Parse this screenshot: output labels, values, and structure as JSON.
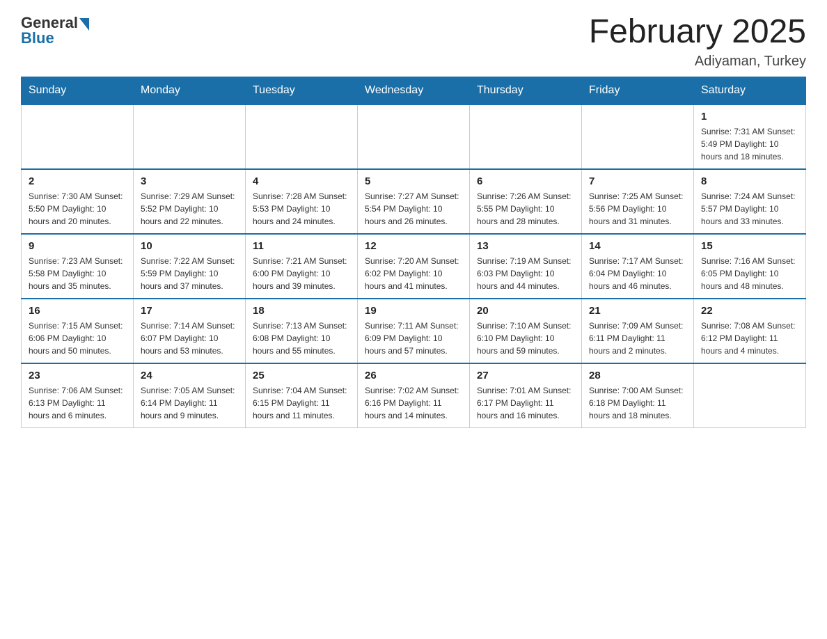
{
  "header": {
    "logo_general": "General",
    "logo_blue": "Blue",
    "month_title": "February 2025",
    "location": "Adiyaman, Turkey"
  },
  "days_of_week": [
    "Sunday",
    "Monday",
    "Tuesday",
    "Wednesday",
    "Thursday",
    "Friday",
    "Saturday"
  ],
  "weeks": [
    [
      {
        "day": "",
        "info": ""
      },
      {
        "day": "",
        "info": ""
      },
      {
        "day": "",
        "info": ""
      },
      {
        "day": "",
        "info": ""
      },
      {
        "day": "",
        "info": ""
      },
      {
        "day": "",
        "info": ""
      },
      {
        "day": "1",
        "info": "Sunrise: 7:31 AM\nSunset: 5:49 PM\nDaylight: 10 hours and 18 minutes."
      }
    ],
    [
      {
        "day": "2",
        "info": "Sunrise: 7:30 AM\nSunset: 5:50 PM\nDaylight: 10 hours and 20 minutes."
      },
      {
        "day": "3",
        "info": "Sunrise: 7:29 AM\nSunset: 5:52 PM\nDaylight: 10 hours and 22 minutes."
      },
      {
        "day": "4",
        "info": "Sunrise: 7:28 AM\nSunset: 5:53 PM\nDaylight: 10 hours and 24 minutes."
      },
      {
        "day": "5",
        "info": "Sunrise: 7:27 AM\nSunset: 5:54 PM\nDaylight: 10 hours and 26 minutes."
      },
      {
        "day": "6",
        "info": "Sunrise: 7:26 AM\nSunset: 5:55 PM\nDaylight: 10 hours and 28 minutes."
      },
      {
        "day": "7",
        "info": "Sunrise: 7:25 AM\nSunset: 5:56 PM\nDaylight: 10 hours and 31 minutes."
      },
      {
        "day": "8",
        "info": "Sunrise: 7:24 AM\nSunset: 5:57 PM\nDaylight: 10 hours and 33 minutes."
      }
    ],
    [
      {
        "day": "9",
        "info": "Sunrise: 7:23 AM\nSunset: 5:58 PM\nDaylight: 10 hours and 35 minutes."
      },
      {
        "day": "10",
        "info": "Sunrise: 7:22 AM\nSunset: 5:59 PM\nDaylight: 10 hours and 37 minutes."
      },
      {
        "day": "11",
        "info": "Sunrise: 7:21 AM\nSunset: 6:00 PM\nDaylight: 10 hours and 39 minutes."
      },
      {
        "day": "12",
        "info": "Sunrise: 7:20 AM\nSunset: 6:02 PM\nDaylight: 10 hours and 41 minutes."
      },
      {
        "day": "13",
        "info": "Sunrise: 7:19 AM\nSunset: 6:03 PM\nDaylight: 10 hours and 44 minutes."
      },
      {
        "day": "14",
        "info": "Sunrise: 7:17 AM\nSunset: 6:04 PM\nDaylight: 10 hours and 46 minutes."
      },
      {
        "day": "15",
        "info": "Sunrise: 7:16 AM\nSunset: 6:05 PM\nDaylight: 10 hours and 48 minutes."
      }
    ],
    [
      {
        "day": "16",
        "info": "Sunrise: 7:15 AM\nSunset: 6:06 PM\nDaylight: 10 hours and 50 minutes."
      },
      {
        "day": "17",
        "info": "Sunrise: 7:14 AM\nSunset: 6:07 PM\nDaylight: 10 hours and 53 minutes."
      },
      {
        "day": "18",
        "info": "Sunrise: 7:13 AM\nSunset: 6:08 PM\nDaylight: 10 hours and 55 minutes."
      },
      {
        "day": "19",
        "info": "Sunrise: 7:11 AM\nSunset: 6:09 PM\nDaylight: 10 hours and 57 minutes."
      },
      {
        "day": "20",
        "info": "Sunrise: 7:10 AM\nSunset: 6:10 PM\nDaylight: 10 hours and 59 minutes."
      },
      {
        "day": "21",
        "info": "Sunrise: 7:09 AM\nSunset: 6:11 PM\nDaylight: 11 hours and 2 minutes."
      },
      {
        "day": "22",
        "info": "Sunrise: 7:08 AM\nSunset: 6:12 PM\nDaylight: 11 hours and 4 minutes."
      }
    ],
    [
      {
        "day": "23",
        "info": "Sunrise: 7:06 AM\nSunset: 6:13 PM\nDaylight: 11 hours and 6 minutes."
      },
      {
        "day": "24",
        "info": "Sunrise: 7:05 AM\nSunset: 6:14 PM\nDaylight: 11 hours and 9 minutes."
      },
      {
        "day": "25",
        "info": "Sunrise: 7:04 AM\nSunset: 6:15 PM\nDaylight: 11 hours and 11 minutes."
      },
      {
        "day": "26",
        "info": "Sunrise: 7:02 AM\nSunset: 6:16 PM\nDaylight: 11 hours and 14 minutes."
      },
      {
        "day": "27",
        "info": "Sunrise: 7:01 AM\nSunset: 6:17 PM\nDaylight: 11 hours and 16 minutes."
      },
      {
        "day": "28",
        "info": "Sunrise: 7:00 AM\nSunset: 6:18 PM\nDaylight: 11 hours and 18 minutes."
      },
      {
        "day": "",
        "info": ""
      }
    ]
  ]
}
